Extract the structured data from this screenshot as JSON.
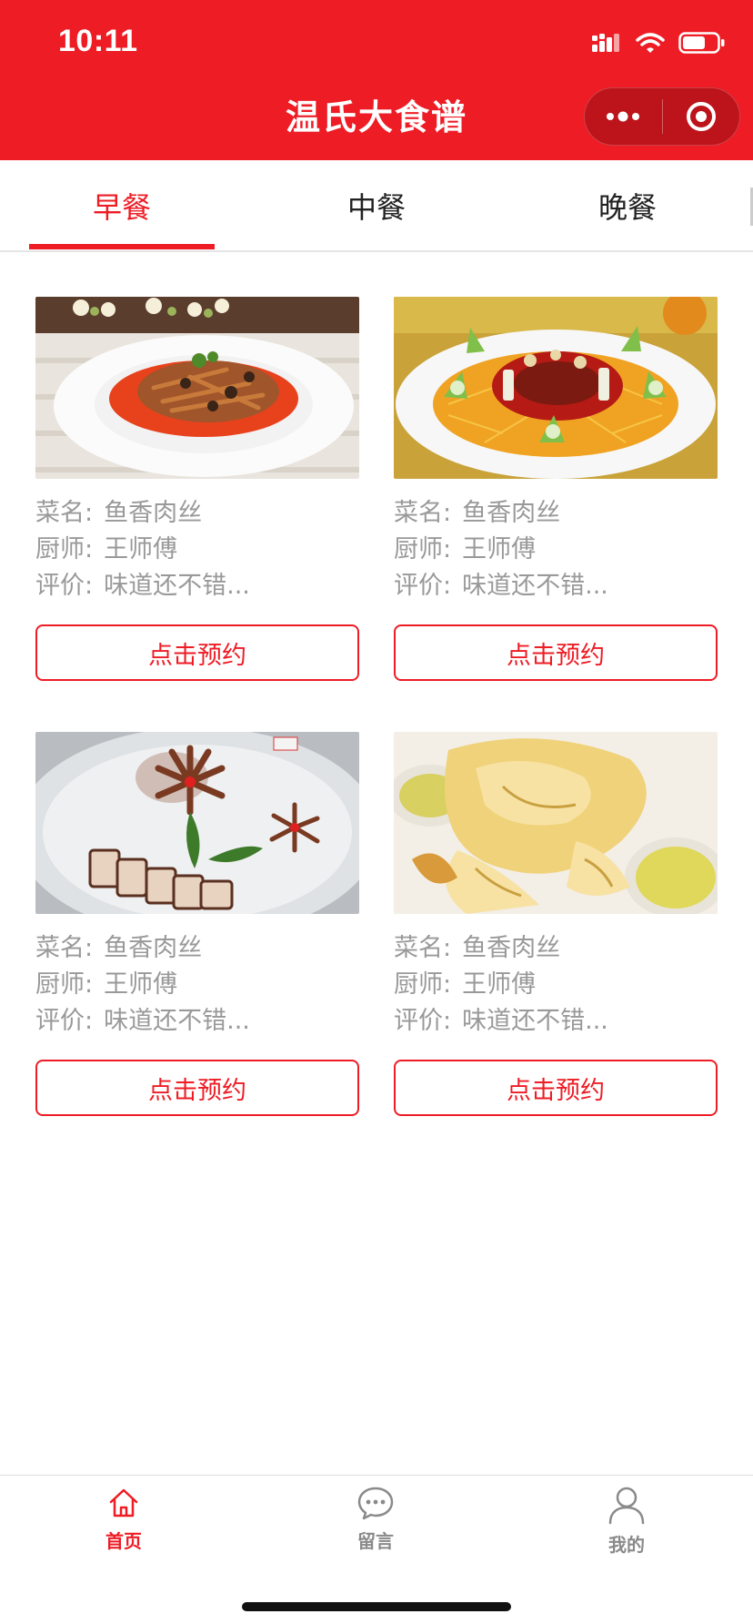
{
  "status_bar": {
    "time": "10:11"
  },
  "nav": {
    "title": "温氏大食谱"
  },
  "tabs": [
    {
      "label": "早餐",
      "active": true
    },
    {
      "label": "中餐",
      "active": false
    },
    {
      "label": "晚餐",
      "active": false
    }
  ],
  "dishes": [
    {
      "name_label": "菜名:",
      "name": "鱼香肉丝",
      "chef_label": "厨师:",
      "chef": "王师傅",
      "rating_label": "评价:",
      "rating": "味道还不错...",
      "button": "点击预约"
    },
    {
      "name_label": "菜名:",
      "name": "鱼香肉丝",
      "chef_label": "厨师:",
      "chef": "王师傅",
      "rating_label": "评价:",
      "rating": "味道还不错...",
      "button": "点击预约"
    },
    {
      "name_label": "菜名:",
      "name": "鱼香肉丝",
      "chef_label": "厨师:",
      "chef": "王师傅",
      "rating_label": "评价:",
      "rating": "味道还不错...",
      "button": "点击预约"
    },
    {
      "name_label": "菜名:",
      "name": "鱼香肉丝",
      "chef_label": "厨师:",
      "chef": "王师傅",
      "rating_label": "评价:",
      "rating": "味道还不错...",
      "button": "点击预约"
    }
  ],
  "tabbar": [
    {
      "label": "首页",
      "icon": "home-icon",
      "active": true
    },
    {
      "label": "留言",
      "icon": "message-icon",
      "active": false
    },
    {
      "label": "我的",
      "icon": "user-icon",
      "active": false
    }
  ],
  "colors": {
    "accent": "#ee1c25",
    "muted": "#999999",
    "inactive": "#8a8a8a"
  }
}
